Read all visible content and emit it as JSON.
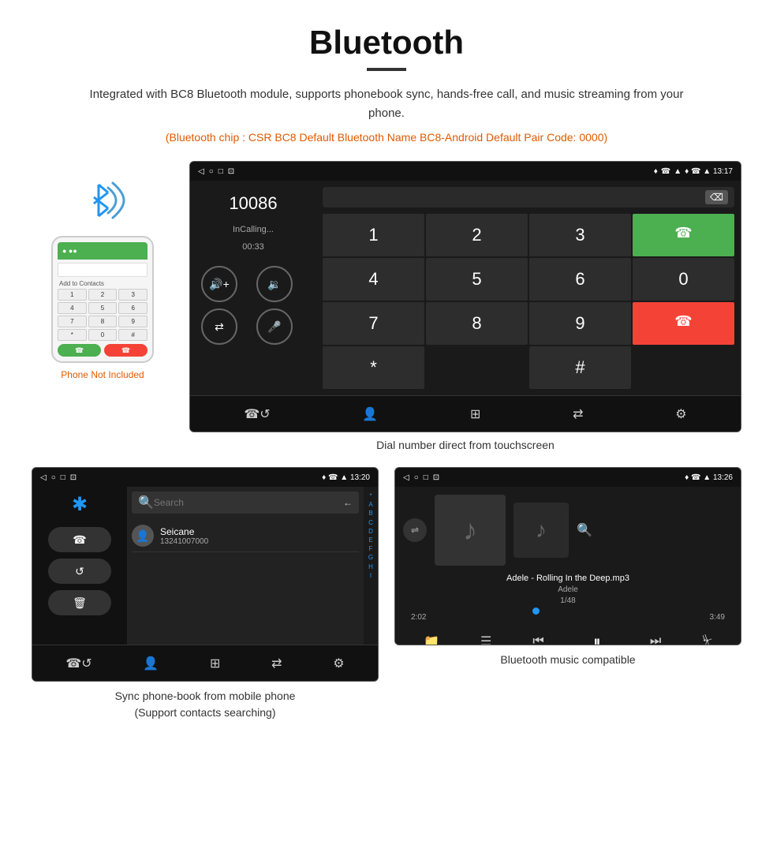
{
  "header": {
    "title": "Bluetooth",
    "divider": true
  },
  "description": {
    "main": "Integrated with BC8 Bluetooth module, supports phonebook sync, hands-free call, and music streaming from your phone.",
    "info": "(Bluetooth chip : CSR BC8    Default Bluetooth Name BC8-Android    Default Pair Code: 0000)"
  },
  "dialer_screen": {
    "status_bar": {
      "left_icons": [
        "◁",
        "○",
        "□",
        "⊡"
      ],
      "right_icons": "♦ ☎ ▲ 13:17"
    },
    "number": "10086",
    "status": "InCalling...",
    "timer": "00:33",
    "keys": [
      "1",
      "2",
      "3",
      "*",
      "4",
      "5",
      "6",
      "0",
      "7",
      "8",
      "9",
      "#"
    ],
    "caption": "Dial number direct from touchscreen"
  },
  "phone_image": {
    "not_included_label": "Phone Not Included"
  },
  "contacts_screen": {
    "status_bar_right": "♦ ☎ ▲ 13:20",
    "contact_name": "Seicane",
    "contact_number": "13241007000",
    "alphabet": [
      "*",
      "A",
      "B",
      "C",
      "D",
      "E",
      "F",
      "G",
      "H",
      "I"
    ],
    "caption_line1": "Sync phone-book from mobile phone",
    "caption_line2": "(Support contacts searching)"
  },
  "music_screen": {
    "status_bar_right": "♦ ☎ ▲ 13:26",
    "song_title": "Adele - Rolling In the Deep.mp3",
    "artist": "Adele",
    "track": "1/48",
    "time_current": "2:02",
    "time_total": "3:49",
    "progress": 40,
    "caption": "Bluetooth music compatible"
  }
}
